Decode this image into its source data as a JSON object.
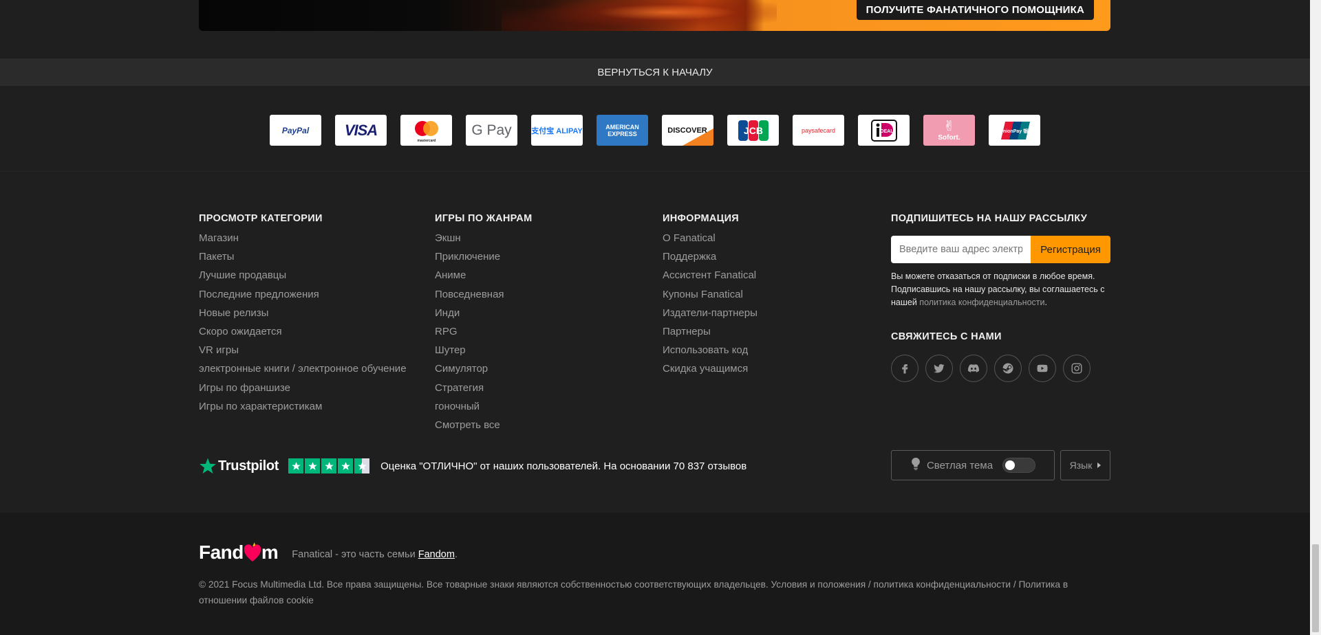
{
  "banner": {
    "cta_label": "ПОЛУЧИТЕ ФАНАТИЧНОГО ПОМОЩНИКА"
  },
  "back_to_top": "ВЕРНУТЬСЯ К НАЧАЛУ",
  "payments": {
    "paypal": "PayPal",
    "visa": "VISA",
    "mastercard": "mastercard",
    "gpay": "G Pay",
    "alipay": "支付宝 ALIPAY",
    "amex_line1": "AMERICAN",
    "amex_line2": "EXPRESS",
    "discover": "DISCOVER",
    "jcb": "JCB",
    "paysafecard": "paysafecard",
    "ideal": "iDEAL",
    "sofort": "Sofort.",
    "unionpay": "UnionPay 银联"
  },
  "columns": {
    "categories": {
      "title": "ПРОСМОТР КАТЕГОРИИ",
      "items": [
        "Магазин",
        "Пакеты",
        "Лучшие продавцы",
        "Последние предложения",
        "Новые релизы",
        "Скоро ожидается",
        "VR игры",
        "электронные книги / электронное обучение",
        "Игры по франшизе",
        "Игры по характеристикам"
      ]
    },
    "genres": {
      "title": "ИГРЫ ПО ЖАНРАМ",
      "items": [
        "Экшн",
        "Приключение",
        "Аниме",
        "Повседневная",
        "Инди",
        "RPG",
        "Шутер",
        "Симулятор",
        "Стратегия",
        "гоночный",
        "Смотреть все"
      ]
    },
    "info": {
      "title": "ИНФОРМАЦИЯ",
      "items": [
        "О Fanatical",
        "Поддержка",
        "Ассистент Fanatical",
        "Купоны Fanatical",
        "Издатели-партнеры",
        "Партнеры",
        "Использовать код",
        "Скидка учащимся"
      ]
    }
  },
  "newsletter": {
    "title": "ПОДПИШИТЕСЬ НА НАШУ РАССЫЛКУ",
    "input_placeholder": "Введите ваш адрес электронной почты",
    "button_label": "Регистрация",
    "note_text": "Вы можете отказаться от подписки в любое время. Подписавшись на нашу рассылку, вы соглашаетесь с нашей ",
    "note_link": "политика конфиденциальности",
    "note_end": "."
  },
  "contact": {
    "title": "СВЯЖИТЕСЬ С НАМИ",
    "icons": [
      "facebook-icon",
      "twitter-icon",
      "discord-icon",
      "steam-icon",
      "youtube-icon",
      "instagram-icon"
    ]
  },
  "trustpilot": {
    "logo_text": "Trustpilot",
    "rating_stars": 4.5,
    "text": "Оценка \"ОТЛИЧНО\" от наших пользователей. На основании 70 837 отзывов"
  },
  "theme_toggle": {
    "label": "Светлая тема",
    "on": false
  },
  "language": {
    "label": "Язык"
  },
  "fandom": {
    "logo_text_a": "Fand",
    "logo_text_b": "m",
    "text": "Fanatical - это часть семьи ",
    "link": "Fandom",
    "end": "."
  },
  "copyright": "© 2021 Focus Multimedia Ltd. Все права защищены. Все товарные знаки являются собственностью соответствующих владельцев. Условия и положения / политика конфиденциальности / Политика в отношении файлов cookie",
  "colors": {
    "accent": "#ff9800",
    "trustpilot_green": "#00b67a",
    "fandom_pink": "#fa005a"
  }
}
